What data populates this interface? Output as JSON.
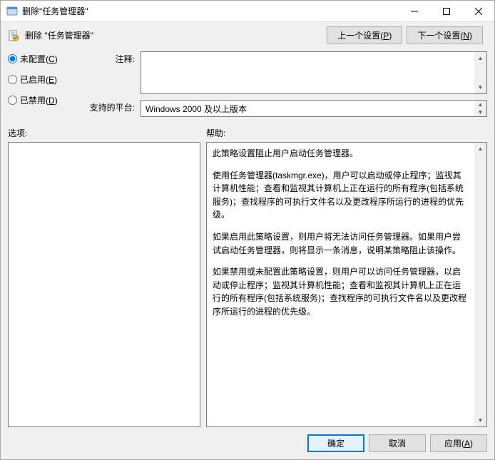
{
  "titlebar": {
    "title": "删除\"任务管理器\""
  },
  "header": {
    "title": "删除 \"任务管理器\"",
    "prev_btn": "上一个设置",
    "prev_key": "P",
    "next_btn": "下一个设置",
    "next_key": "N"
  },
  "radios": {
    "not_configured": "未配置",
    "not_configured_key": "C",
    "enabled": "已启用",
    "enabled_key": "E",
    "disabled": "已禁用",
    "disabled_key": "D"
  },
  "labels": {
    "comment": "注释:",
    "platform": "支持的平台:",
    "options": "选项:",
    "help": "帮助:"
  },
  "platform": {
    "text": "Windows 2000 及以上版本"
  },
  "help": {
    "p1": "此策略设置阻止用户启动任务管理器。",
    "p2": "使用任务管理器(taskmgr.exe)，用户可以启动或停止程序；监视其计算机性能；查看和监视其计算机上正在运行的所有程序(包括系统服务)；查找程序的可执行文件名以及更改程序所运行的进程的优先级。",
    "p3": "如果启用此策略设置，则用户将无法访问任务管理器。如果用户尝试启动任务管理器，则将显示一条消息，说明某策略阻止该操作。",
    "p4": "如果禁用或未配置此策略设置，则用户可以访问任务管理器，以启动或停止程序；监视其计算机性能；查看和监视其计算机上正在运行的所有程序(包括系统服务)；查找程序的可执行文件名以及更改程序所运行的进程的优先级。"
  },
  "footer": {
    "ok": "确定",
    "cancel": "取消",
    "apply": "应用",
    "apply_key": "A"
  }
}
